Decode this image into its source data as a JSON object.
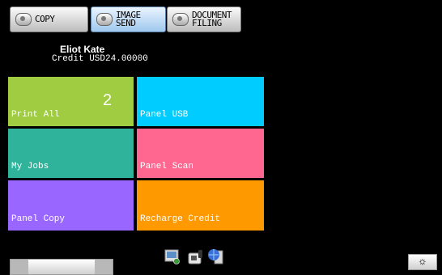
{
  "tabs": [
    {
      "label": "COPY",
      "active": false
    },
    {
      "label": "IMAGE SEND",
      "active": true
    },
    {
      "label_line1": "DOCUMENT",
      "label_line2": "FILING",
      "active": false
    }
  ],
  "user": {
    "name": "Eliot Kate",
    "credit": "Credit USD24.00000"
  },
  "tiles": [
    {
      "label": "Print All",
      "count": "2",
      "color": "#9fcc40"
    },
    {
      "label": "Panel USB",
      "color": "#00ccff"
    },
    {
      "label": "My Jobs",
      "color": "#2fb39a"
    },
    {
      "label": "Panel Scan",
      "color": "#ff6690"
    },
    {
      "label": "Panel Copy",
      "color": "#9966ff"
    },
    {
      "label": "Recharge Credit",
      "color": "#ff9900"
    }
  ],
  "status_icons": [
    "network-scan-icon",
    "phone-fax-icon",
    "server-globe-icon"
  ],
  "brightness_glyph": "☼"
}
